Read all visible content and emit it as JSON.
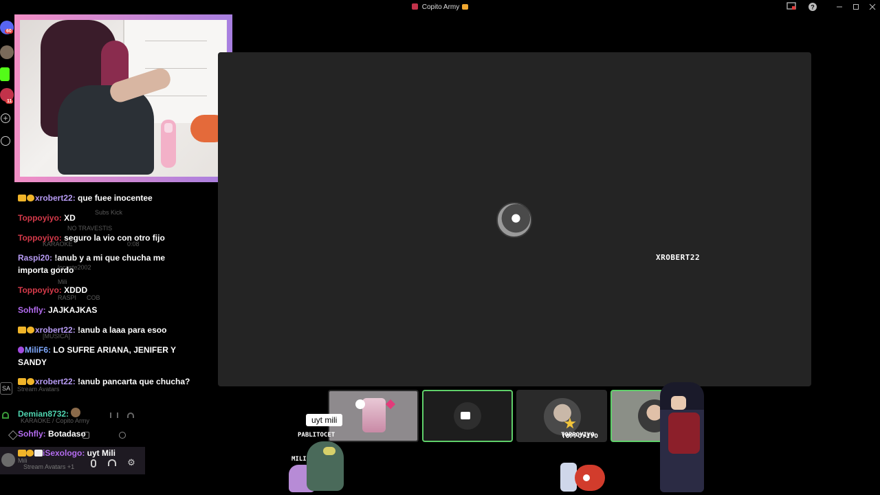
{
  "window": {
    "title": "Copito Army",
    "icons": [
      "screenshare-icon",
      "help-icon",
      "minimize-icon",
      "maximize-icon",
      "close-icon"
    ]
  },
  "sidebar": {
    "badges": {
      "discord": "60",
      "server": "11"
    }
  },
  "chat": {
    "messages": [
      {
        "user": "xrobert22:",
        "text": " que fuee inocentee",
        "color": "#b89cf5",
        "badges": true
      },
      {
        "user": "Toppoyiyo:",
        "text": " XD",
        "color": "#d63a4a",
        "badges": false
      },
      {
        "user": "Toppoyiyo:",
        "text": " seguro la vio con otro fijo",
        "color": "#d63a4a",
        "badges": false
      },
      {
        "user": "Raspi20:",
        "text": " !anub y a mi que chucha me importa gordo",
        "color": "#b89cf5",
        "badges": false
      },
      {
        "user": "Toppoyiyo:",
        "text": " XDDD",
        "color": "#d63a4a",
        "badges": false
      },
      {
        "user": "Sohfly:",
        "text": " JAJKAJKAS",
        "color": "#b46cf0",
        "badges": false
      },
      {
        "user": "xrobert22:",
        "text": " !anub a laaa para esoo",
        "color": "#b89cf5",
        "badges": true
      },
      {
        "user": "MiliF6:",
        "text": " LO SUFRE ARIANA, JENIFER Y SANDY",
        "color": "#7fa9ff",
        "badges": false
      },
      {
        "user": "xrobert22:",
        "text": " !anub pancarta que chucha?",
        "color": "#b89cf5",
        "badges": true
      },
      {
        "user": "Demian8732:",
        "text": "",
        "color": "#4fd4b0",
        "badges": false
      },
      {
        "user": "Sohfly:",
        "text": " Botadaso",
        "color": "#b46cf0",
        "badges": false
      },
      {
        "user": "iSexologo:",
        "text": " uyt Mili",
        "color": "#b46cf0",
        "badges": true
      }
    ]
  },
  "overlay_ghost": {
    "subs": "Subs Kick",
    "no_travestis": "NO TRAVESTIS",
    "karaoke": "KARAOKE",
    "time": "0:08",
    "user1": "locaste2002",
    "mili": "Mili",
    "raspi": "RASPI",
    "cob": "COB",
    "musica": "[MUSICA]",
    "stream_avatars": "Stream Avatars",
    "karaoke_copito": "KARAOKE / Copito Army",
    "mili2": "Mili",
    "stream_avatars_plus": "Stream Avatars +1"
  },
  "stage": {
    "speaker_name": "XROBERT22"
  },
  "tiles": [
    {
      "name": "PABLITOCET",
      "border": "#2a2a2a",
      "bg": "#8e8a8d"
    },
    {
      "name": "",
      "border": "#5fd06a",
      "bg": "#1d1d1d"
    },
    {
      "name": "TOPPOYIYO",
      "border": "#2a2a2a",
      "bg": "#2a2a2a"
    },
    {
      "name": "",
      "border": "#5fd06a",
      "bg": "#8b8f87"
    }
  ],
  "avatars": {
    "bubble": "uyt mili",
    "milif6": "MILIF6"
  }
}
